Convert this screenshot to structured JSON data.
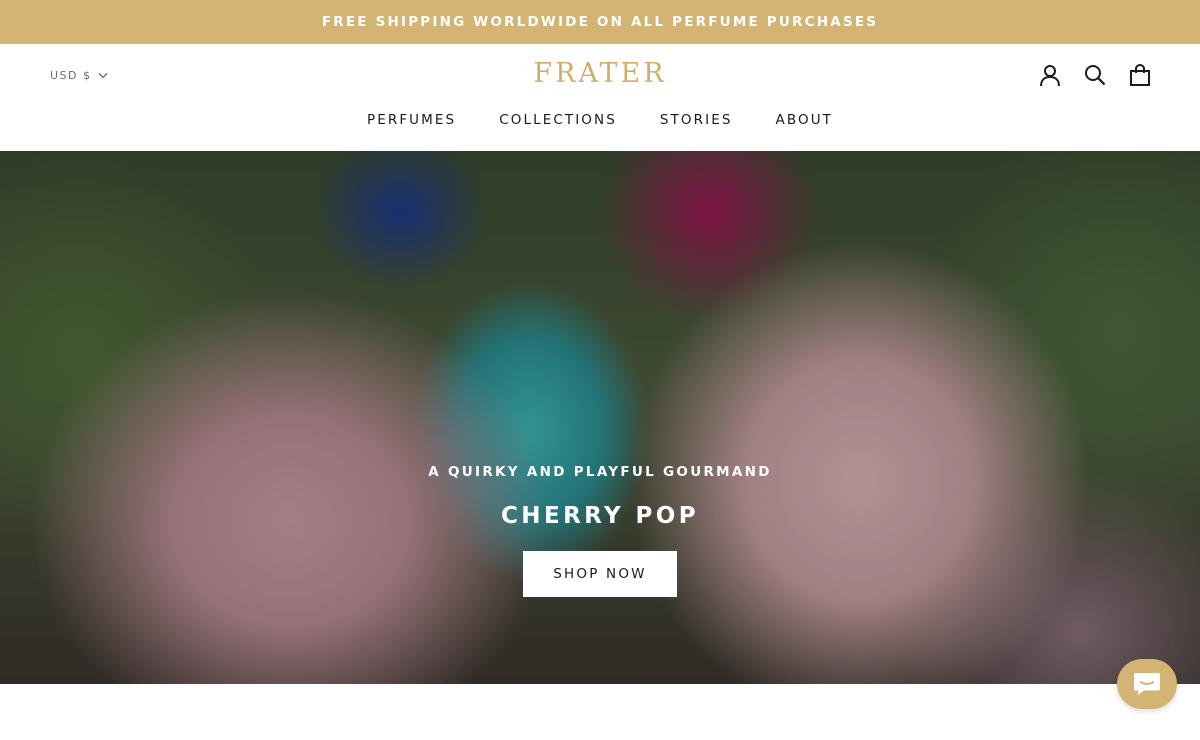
{
  "announcement": "FREE SHIPPING WORLDWIDE ON ALL PERFUME PURCHASES",
  "header": {
    "currency": "USD $",
    "logo": "FRATER",
    "icons": [
      "account-icon",
      "search-icon",
      "cart-icon"
    ]
  },
  "nav": {
    "items": [
      {
        "label": "PERFUMES"
      },
      {
        "label": "COLLECTIONS"
      },
      {
        "label": "STORIES"
      },
      {
        "label": "ABOUT"
      }
    ]
  },
  "hero": {
    "subtitle": "A QUIRKY AND PLAYFUL GOURMAND",
    "title": "CHERRY POP",
    "button_label": "SHOP NOW"
  },
  "colors": {
    "accent": "#d4b474",
    "logo": "#d1ad6a",
    "text": "#1c1b1b"
  },
  "chat": {
    "icon": "chat-icon"
  }
}
